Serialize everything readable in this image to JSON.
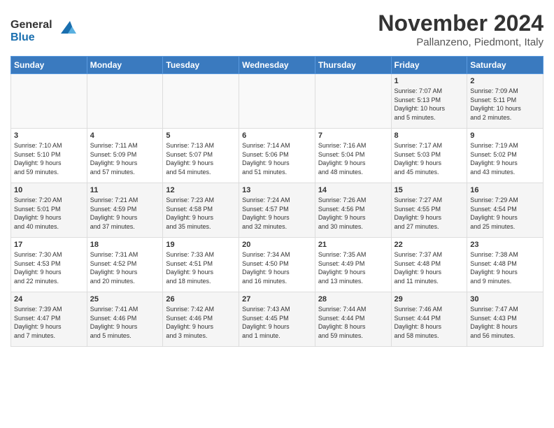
{
  "logo": {
    "line1": "General",
    "line2": "Blue"
  },
  "title": "November 2024",
  "location": "Pallanzeno, Piedmont, Italy",
  "weekdays": [
    "Sunday",
    "Monday",
    "Tuesday",
    "Wednesday",
    "Thursday",
    "Friday",
    "Saturday"
  ],
  "weeks": [
    [
      {
        "day": "",
        "info": ""
      },
      {
        "day": "",
        "info": ""
      },
      {
        "day": "",
        "info": ""
      },
      {
        "day": "",
        "info": ""
      },
      {
        "day": "",
        "info": ""
      },
      {
        "day": "1",
        "info": "Sunrise: 7:07 AM\nSunset: 5:13 PM\nDaylight: 10 hours\nand 5 minutes."
      },
      {
        "day": "2",
        "info": "Sunrise: 7:09 AM\nSunset: 5:11 PM\nDaylight: 10 hours\nand 2 minutes."
      }
    ],
    [
      {
        "day": "3",
        "info": "Sunrise: 7:10 AM\nSunset: 5:10 PM\nDaylight: 9 hours\nand 59 minutes."
      },
      {
        "day": "4",
        "info": "Sunrise: 7:11 AM\nSunset: 5:09 PM\nDaylight: 9 hours\nand 57 minutes."
      },
      {
        "day": "5",
        "info": "Sunrise: 7:13 AM\nSunset: 5:07 PM\nDaylight: 9 hours\nand 54 minutes."
      },
      {
        "day": "6",
        "info": "Sunrise: 7:14 AM\nSunset: 5:06 PM\nDaylight: 9 hours\nand 51 minutes."
      },
      {
        "day": "7",
        "info": "Sunrise: 7:16 AM\nSunset: 5:04 PM\nDaylight: 9 hours\nand 48 minutes."
      },
      {
        "day": "8",
        "info": "Sunrise: 7:17 AM\nSunset: 5:03 PM\nDaylight: 9 hours\nand 45 minutes."
      },
      {
        "day": "9",
        "info": "Sunrise: 7:19 AM\nSunset: 5:02 PM\nDaylight: 9 hours\nand 43 minutes."
      }
    ],
    [
      {
        "day": "10",
        "info": "Sunrise: 7:20 AM\nSunset: 5:01 PM\nDaylight: 9 hours\nand 40 minutes."
      },
      {
        "day": "11",
        "info": "Sunrise: 7:21 AM\nSunset: 4:59 PM\nDaylight: 9 hours\nand 37 minutes."
      },
      {
        "day": "12",
        "info": "Sunrise: 7:23 AM\nSunset: 4:58 PM\nDaylight: 9 hours\nand 35 minutes."
      },
      {
        "day": "13",
        "info": "Sunrise: 7:24 AM\nSunset: 4:57 PM\nDaylight: 9 hours\nand 32 minutes."
      },
      {
        "day": "14",
        "info": "Sunrise: 7:26 AM\nSunset: 4:56 PM\nDaylight: 9 hours\nand 30 minutes."
      },
      {
        "day": "15",
        "info": "Sunrise: 7:27 AM\nSunset: 4:55 PM\nDaylight: 9 hours\nand 27 minutes."
      },
      {
        "day": "16",
        "info": "Sunrise: 7:29 AM\nSunset: 4:54 PM\nDaylight: 9 hours\nand 25 minutes."
      }
    ],
    [
      {
        "day": "17",
        "info": "Sunrise: 7:30 AM\nSunset: 4:53 PM\nDaylight: 9 hours\nand 22 minutes."
      },
      {
        "day": "18",
        "info": "Sunrise: 7:31 AM\nSunset: 4:52 PM\nDaylight: 9 hours\nand 20 minutes."
      },
      {
        "day": "19",
        "info": "Sunrise: 7:33 AM\nSunset: 4:51 PM\nDaylight: 9 hours\nand 18 minutes."
      },
      {
        "day": "20",
        "info": "Sunrise: 7:34 AM\nSunset: 4:50 PM\nDaylight: 9 hours\nand 16 minutes."
      },
      {
        "day": "21",
        "info": "Sunrise: 7:35 AM\nSunset: 4:49 PM\nDaylight: 9 hours\nand 13 minutes."
      },
      {
        "day": "22",
        "info": "Sunrise: 7:37 AM\nSunset: 4:48 PM\nDaylight: 9 hours\nand 11 minutes."
      },
      {
        "day": "23",
        "info": "Sunrise: 7:38 AM\nSunset: 4:48 PM\nDaylight: 9 hours\nand 9 minutes."
      }
    ],
    [
      {
        "day": "24",
        "info": "Sunrise: 7:39 AM\nSunset: 4:47 PM\nDaylight: 9 hours\nand 7 minutes."
      },
      {
        "day": "25",
        "info": "Sunrise: 7:41 AM\nSunset: 4:46 PM\nDaylight: 9 hours\nand 5 minutes."
      },
      {
        "day": "26",
        "info": "Sunrise: 7:42 AM\nSunset: 4:46 PM\nDaylight: 9 hours\nand 3 minutes."
      },
      {
        "day": "27",
        "info": "Sunrise: 7:43 AM\nSunset: 4:45 PM\nDaylight: 9 hours\nand 1 minute."
      },
      {
        "day": "28",
        "info": "Sunrise: 7:44 AM\nSunset: 4:44 PM\nDaylight: 8 hours\nand 59 minutes."
      },
      {
        "day": "29",
        "info": "Sunrise: 7:46 AM\nSunset: 4:44 PM\nDaylight: 8 hours\nand 58 minutes."
      },
      {
        "day": "30",
        "info": "Sunrise: 7:47 AM\nSunset: 4:43 PM\nDaylight: 8 hours\nand 56 minutes."
      }
    ]
  ]
}
